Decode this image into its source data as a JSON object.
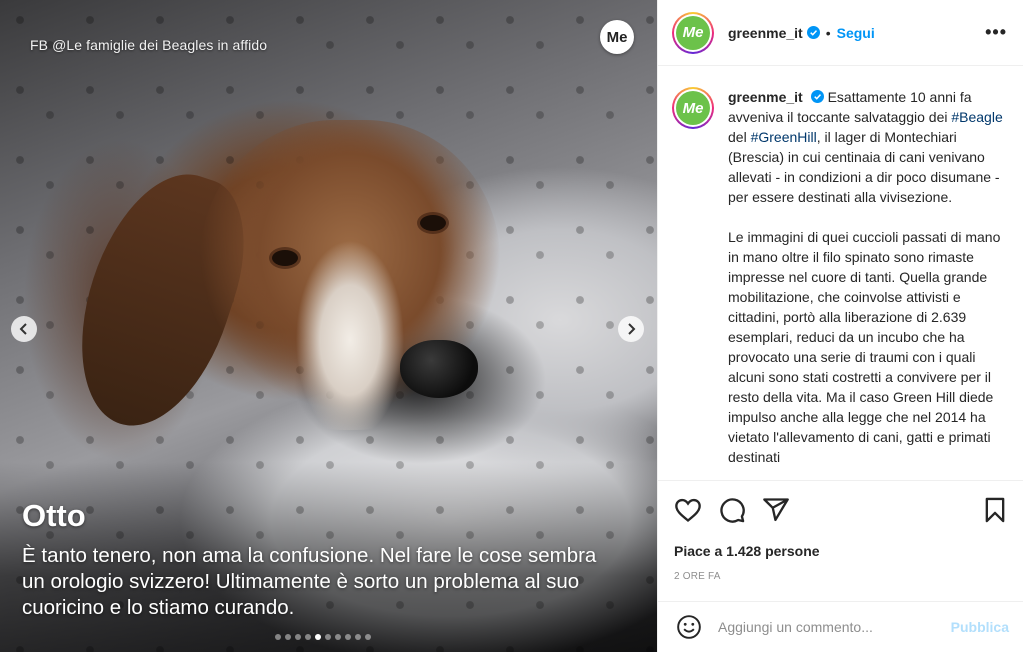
{
  "media": {
    "credit": "FB @Le famiglie dei Beagles in affido",
    "logo": "Me",
    "title": "Otto",
    "body": "È tanto tenero, non ama la confusione. Nel fare le cose sembra un orologio svizzero! Ultimamente è sorto un problema al suo cuoricino e lo stiamo curando.",
    "carousel": {
      "total": 10,
      "active_index": 4
    }
  },
  "header": {
    "username": "greenme_it",
    "bullet": "•",
    "follow": "Segui",
    "more": "•••",
    "avatar_text": "Me"
  },
  "caption": {
    "username": "greenme_it",
    "p1_a": "Esattamente 10 anni fa avveniva il toccante salvataggio dei ",
    "tag1": "#Beagle",
    "p1_b": " del ",
    "tag2": "#GreenHill",
    "p1_c": ", il lager di Montechiari (Brescia) in cui centinaia di cani venivano allevati - in condizioni a dir poco disumane - per essere destinati alla vivisezione.",
    "p2": "Le immagini di quei cuccioli passati di mano in mano oltre il filo spinato sono rimaste impresse nel cuore di tanti. Quella grande mobilitazione, che coinvolse attivisti e cittadini, portò alla liberazione di 2.639 esemplari, reduci da un incubo che ha provocato una serie di traumi con i quali alcuni sono stati costretti a convivere per il resto della vita. Ma il caso Green Hill diede impulso anche alla legge che nel 2014 ha vietato l'allevamento di cani, gatti e primati destinati"
  },
  "actions": {
    "likes": "Piace a 1.428 persone",
    "time": "2 ORE FA"
  },
  "comment_box": {
    "placeholder": "Aggiungi un commento...",
    "post": "Pubblica"
  },
  "colors": {
    "accent": "#0095f6",
    "post_disabled": "#b2dffc",
    "hashtag": "#00376b"
  }
}
